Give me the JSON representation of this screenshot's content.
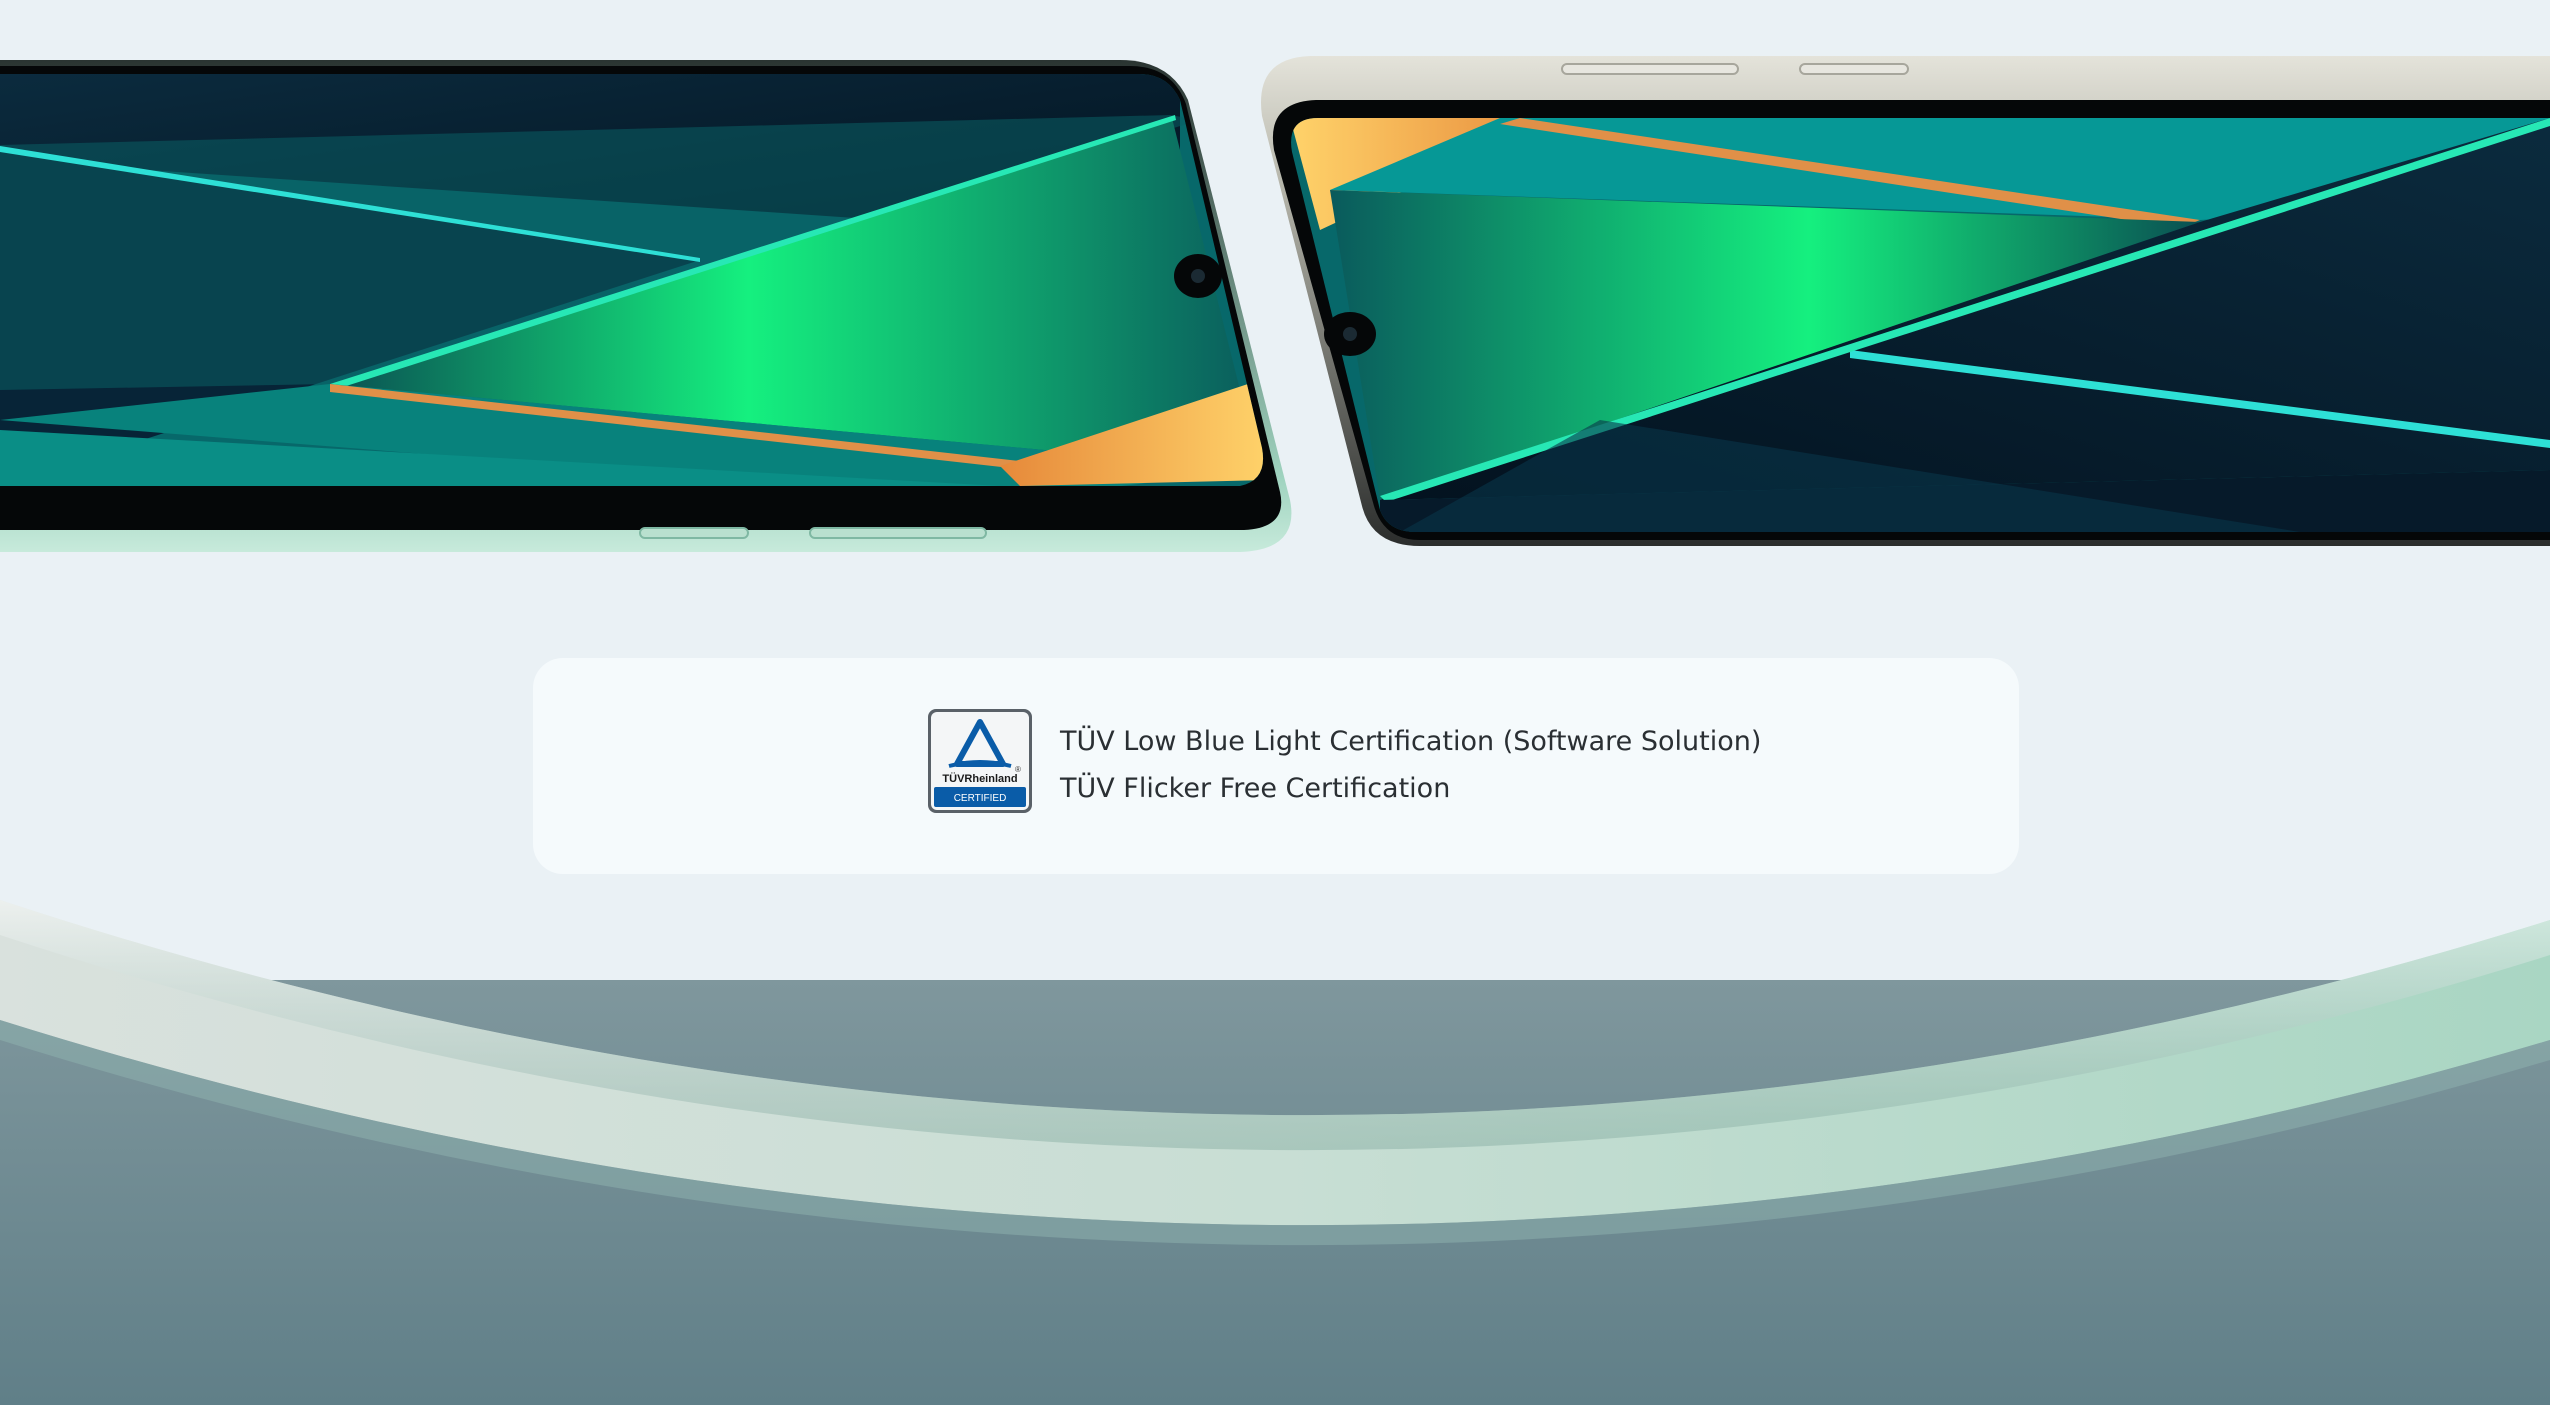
{
  "certification": {
    "badge": {
      "icon": "tuv-rheinland-certified-badge",
      "brand_text": "TÜVRheinland",
      "certified_text": "CERTIFIED",
      "registered_mark": "®"
    },
    "items": [
      "TÜV Low Blue Light Certification (Software Solution)",
      "TÜV Flicker Free Certification"
    ]
  },
  "colors": {
    "page_background": "#eaf1f5",
    "card_background": "#f5fafc",
    "text": "#2a2f33",
    "screen_green": "#1de27e",
    "screen_teal": "#0b8f86",
    "screen_navy": "#06182a",
    "accent_orange": "#f6b04e",
    "frame_mint": "#bfe4d2",
    "frame_silver": "#d5d5cc",
    "lower_background": "#628189",
    "tuv_blue": "#0a5ca8"
  }
}
